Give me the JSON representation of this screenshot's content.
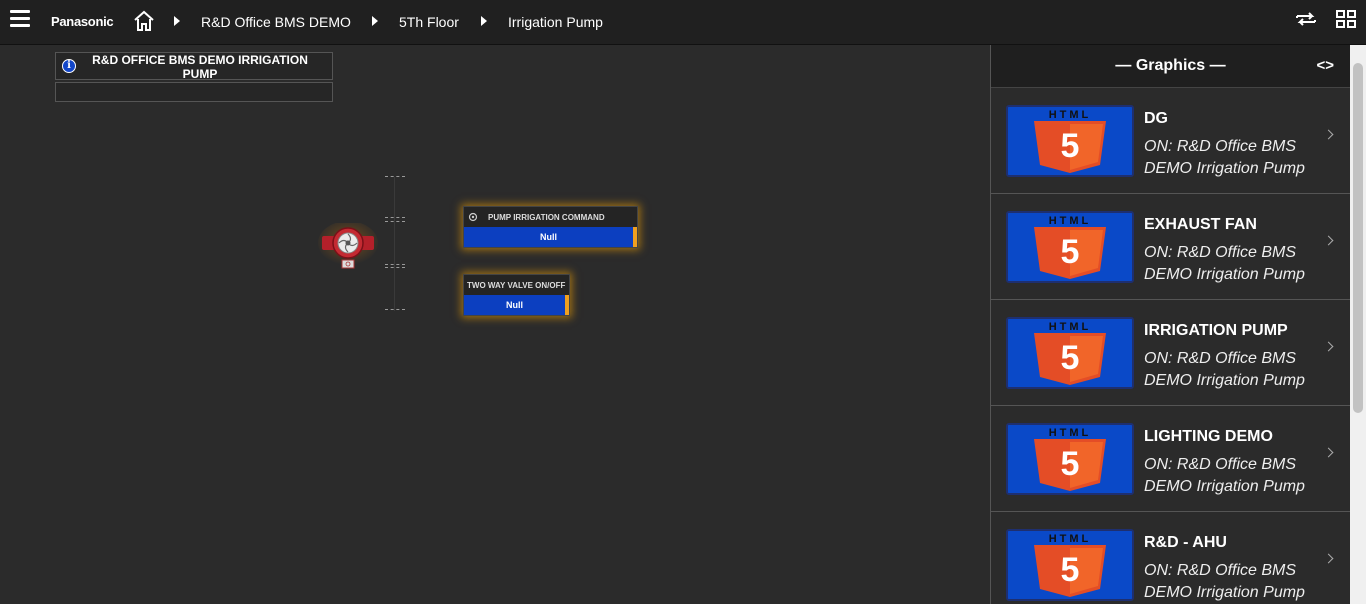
{
  "header": {
    "brand": "Panasonic",
    "breadcrumbs": [
      "R&D Office BMS DEMO",
      "5Th Floor",
      "Irrigation Pump"
    ],
    "icons": [
      "menu-icon",
      "home-icon",
      "swap-icon",
      "grid-icon"
    ]
  },
  "canvas": {
    "title": "R&D OFFICE BMS DEMO IRRIGATION PUMP",
    "points": [
      {
        "label": "PUMP IRRIGATION COMMAND",
        "value": "Null",
        "icon": "gear-icon"
      },
      {
        "label": "TWO WAY VALVE ON/OFF",
        "value": "Null"
      }
    ],
    "accent": "#0c3fc0",
    "glow": "#f0a020"
  },
  "panel": {
    "title": "— Graphics —",
    "toggle": "<>",
    "items": [
      {
        "title": "DG",
        "subtitle": "ON: R&D Office BMS DEMO Irrigation Pump"
      },
      {
        "title": "EXHAUST FAN",
        "subtitle": "ON: R&D Office BMS DEMO Irrigation Pump"
      },
      {
        "title": "IRRIGATION PUMP",
        "subtitle": "ON: R&D Office BMS DEMO Irrigation Pump"
      },
      {
        "title": "LIGHTING DEMO",
        "subtitle": "ON: R&D Office BMS DEMO Irrigation Pump"
      },
      {
        "title": "R&D - AHU",
        "subtitle": "ON: R&D Office BMS DEMO Irrigation Pump"
      }
    ],
    "thumb_text": "HTML",
    "thumb_number": "5"
  }
}
